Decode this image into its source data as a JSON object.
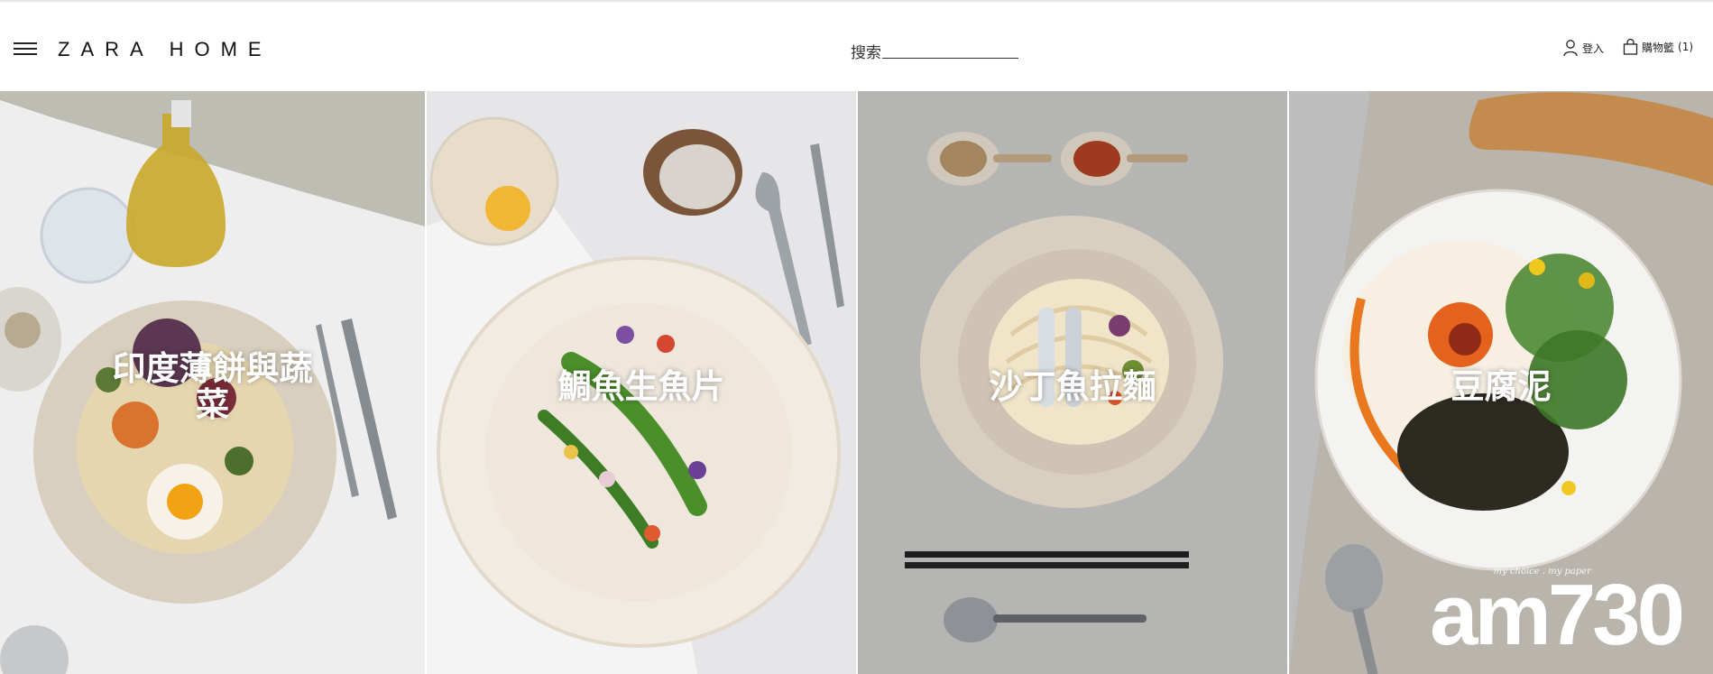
{
  "header": {
    "logo": "ZARA HOME",
    "search_label": "搜索",
    "login_label": "登入",
    "cart_label": "購物籃",
    "cart_count": "(1)"
  },
  "panels": [
    {
      "caption_line1": "印度薄餅與蔬",
      "caption_line2": "菜"
    },
    {
      "caption_line1": "鯛魚生魚片"
    },
    {
      "caption_line1": "沙丁魚拉麵"
    },
    {
      "caption_line1": "豆腐泥"
    }
  ],
  "watermark": {
    "tagline": "my choice . my paper",
    "logo": "am730"
  },
  "colors": {
    "header_bg": "#ffffff",
    "caption": "#ffffff",
    "text": "#222222"
  }
}
